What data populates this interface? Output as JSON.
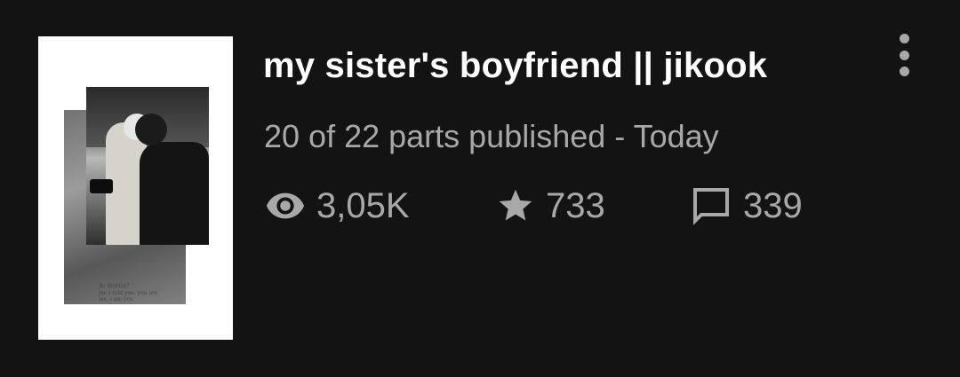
{
  "story": {
    "title": "my sister's boyfriend || jikook",
    "parts_status": "20 of 22 parts published - Today",
    "cover": {
      "caption": "jk: destiny?\njm: i told you. you are\nme, i am you"
    },
    "stats": {
      "views": {
        "icon": "eye-icon",
        "value": "3,05K"
      },
      "votes": {
        "icon": "star-icon",
        "value": "733"
      },
      "comments": {
        "icon": "comment-icon",
        "value": "339"
      }
    }
  },
  "menu": {
    "icon": "more-vertical-icon"
  },
  "colors": {
    "background": "#131313",
    "title": "#ffffff",
    "muted": "#a8a8a8"
  }
}
